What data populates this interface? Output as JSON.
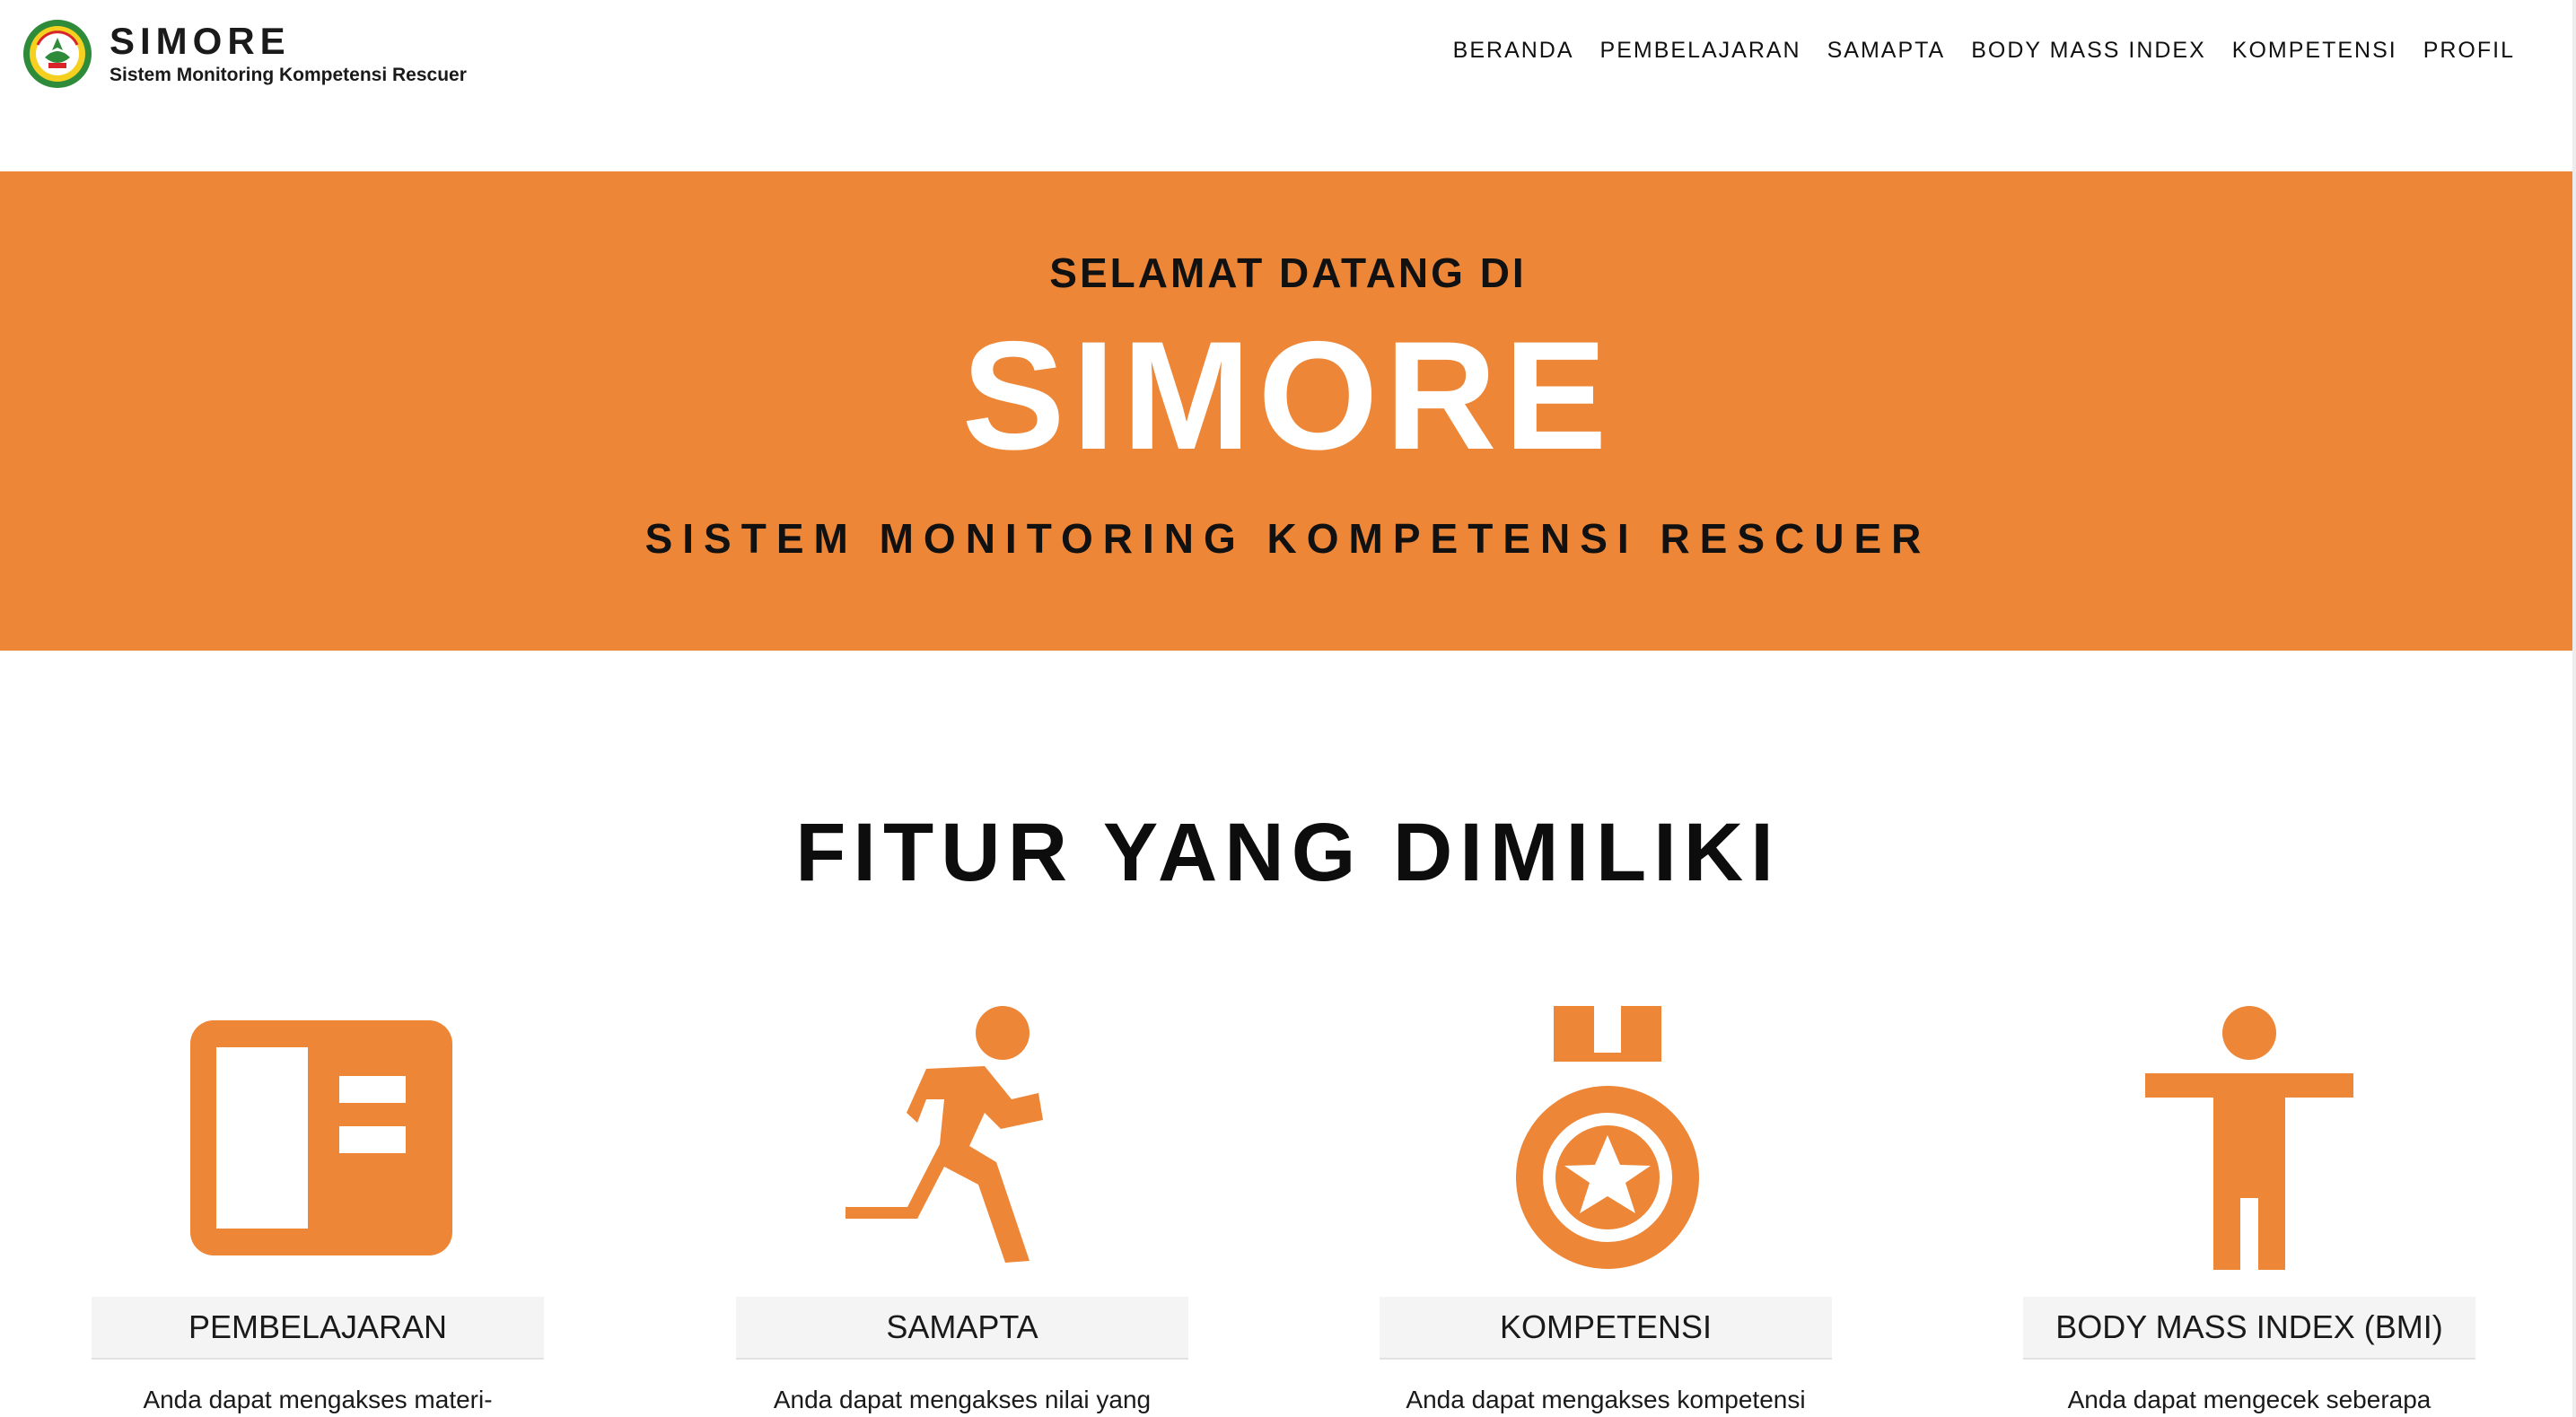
{
  "brand": {
    "logo": "basarnas-emblem-logo",
    "title": "SIMORE",
    "subtitle": "Sistem Monitoring Kompetensi Rescuer"
  },
  "nav": [
    {
      "label": "BERANDA"
    },
    {
      "label": "PEMBELAJARAN"
    },
    {
      "label": "SAMAPTA"
    },
    {
      "label": "BODY MASS INDEX"
    },
    {
      "label": "KOMPETENSI"
    },
    {
      "label": "PROFIL"
    }
  ],
  "hero": {
    "kicker": "SELAMAT DATANG DI",
    "title": "SIMORE",
    "subtitle": "SISTEM MONITORING KOMPETENSI RESCUER"
  },
  "features": {
    "title": "FITUR YANG DIMILIKI",
    "cards": [
      {
        "icon": "dashboard-panel-icon",
        "label": "PEMBELAJARAN",
        "desc": "Anda dapat mengakses materi-"
      },
      {
        "icon": "running-person-icon",
        "label": "SAMAPTA",
        "desc": "Anda dapat mengakses nilai yang"
      },
      {
        "icon": "medal-star-icon",
        "label": "KOMPETENSI",
        "desc": "Anda dapat mengakses kompetensi"
      },
      {
        "icon": "person-standing-icon",
        "label": "BODY MASS INDEX (BMI)",
        "desc": "Anda dapat mengecek seberapa"
      }
    ]
  },
  "colors": {
    "accent": "#ed8636",
    "text": "#111111",
    "card_label_bg": "#f4f4f4"
  }
}
